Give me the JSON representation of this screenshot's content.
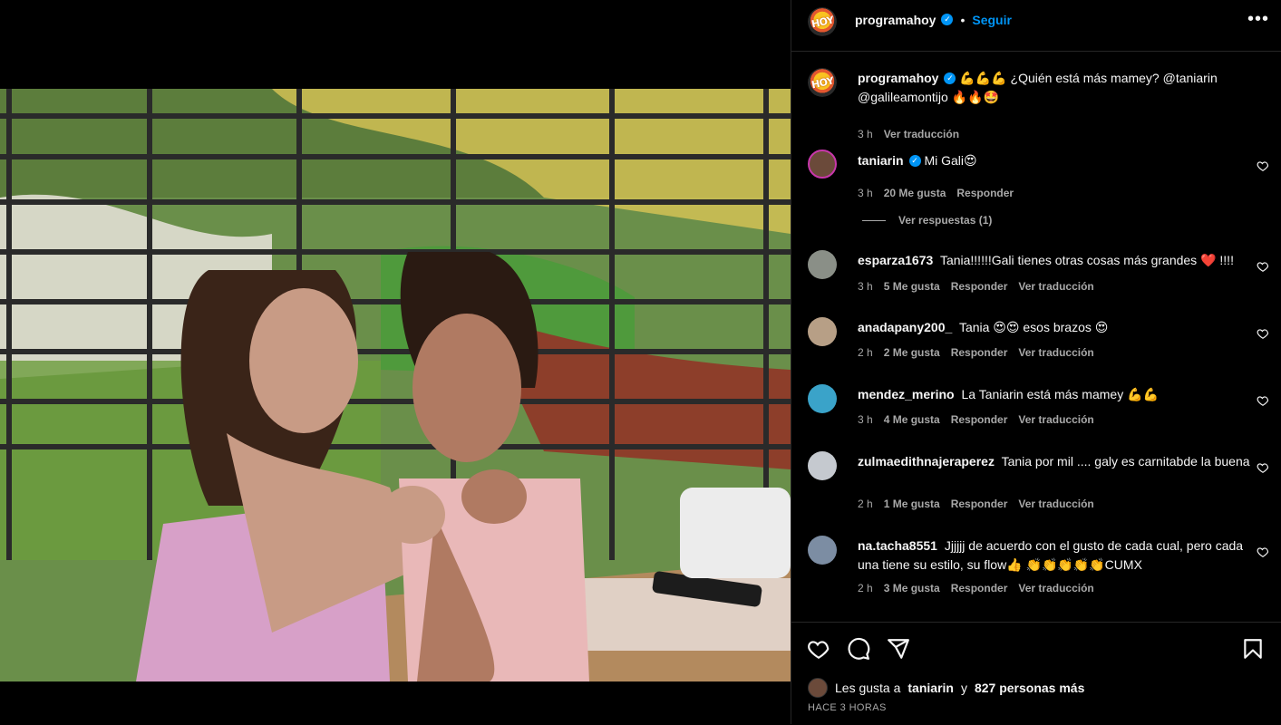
{
  "post": {
    "author": "programahoy",
    "avatar_text": "HOY",
    "follow_label": "Seguir",
    "more_label": "•••",
    "separator": "•"
  },
  "caption": {
    "author": "programahoy",
    "text": "💪💪💪 ¿Quién está más mamey? @taniarin @galileamontijo 🔥🔥🤩",
    "time": "3 h",
    "translate": "Ver traducción"
  },
  "comments": [
    {
      "author": "taniarin",
      "verified": true,
      "text": "Mi Gali😍",
      "time": "3 h",
      "likes": "20 Me gusta",
      "reply": "Responder",
      "translate": "",
      "replies_label": "Ver respuestas (1)"
    },
    {
      "author": "esparza1673",
      "verified": false,
      "text": "Tania!!!!!!Gali tienes otras cosas más grandes ❤️ !!!!",
      "time": "3 h",
      "likes": "5 Me gusta",
      "reply": "Responder",
      "translate": "Ver traducción"
    },
    {
      "author": "anadapany200_",
      "verified": false,
      "text": "Tania 😍😍 esos brazos 😍",
      "time": "2 h",
      "likes": "2 Me gusta",
      "reply": "Responder",
      "translate": "Ver traducción"
    },
    {
      "author": "mendez_merino",
      "verified": false,
      "text": "La Taniarin está más mamey 💪💪",
      "time": "3 h",
      "likes": "4 Me gusta",
      "reply": "Responder",
      "translate": "Ver traducción"
    },
    {
      "author": "zulmaedithnajeraperez",
      "verified": false,
      "text": "Tania por mil .... galy es carnitabde la buena",
      "time": "2 h",
      "likes": "1 Me gusta",
      "reply": "Responder",
      "translate": "Ver traducción"
    },
    {
      "author": "na.tacha8551",
      "verified": false,
      "text": "Jjjjjj de acuerdo con el gusto de cada cual, pero cada una tiene su estilo, su flow👍 👏👏👏👏👏CUMX",
      "time": "2 h",
      "likes": "3 Me gusta",
      "reply": "Responder",
      "translate": "Ver traducción"
    }
  ],
  "likes": {
    "prefix": "Les gusta a",
    "user": "taniarin",
    "connector": "y",
    "others": "827 personas más"
  },
  "timestamp": "HACE 3 HORAS",
  "icons": [
    "heart-icon",
    "comment-icon",
    "share-icon",
    "bookmark-icon",
    "more-icon",
    "verified-icon"
  ],
  "colors": {
    "accent": "#0095f6",
    "muted": "#a8a8a8",
    "background": "#000000"
  }
}
